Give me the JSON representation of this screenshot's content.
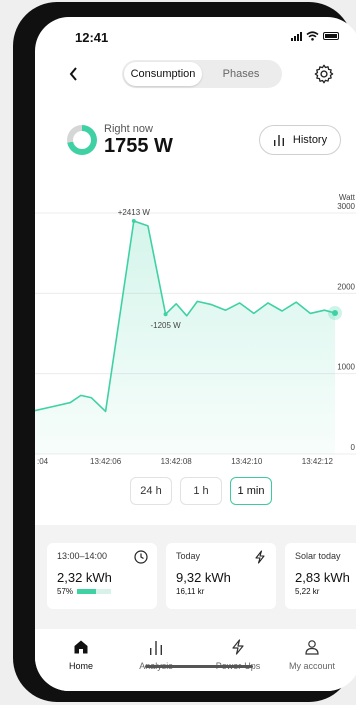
{
  "status": {
    "time": "12:41"
  },
  "tabs": [
    {
      "label": "Consumption",
      "active": true
    },
    {
      "label": "Phases",
      "active": false
    }
  ],
  "now": {
    "label": "Right now",
    "value": "1755 W",
    "fill_fraction": 0.72
  },
  "history_button": "History",
  "chart_data": {
    "type": "area",
    "unit_label": "Watt",
    "y_ticks": [
      "3000",
      "2000",
      "1000",
      "0"
    ],
    "ylim": [
      0,
      3000
    ],
    "x_tick_labels": [
      ":04",
      "13:42:06",
      "13:42:08",
      "13:42:10",
      "13:42:12"
    ],
    "x_ticks": [
      4,
      6,
      8,
      10,
      12
    ],
    "xlim": [
      4,
      12.5
    ],
    "points": [
      [
        4.0,
        540
      ],
      [
        4.5,
        590
      ],
      [
        5.0,
        640
      ],
      [
        5.3,
        730
      ],
      [
        5.6,
        700
      ],
      [
        6.0,
        530
      ],
      [
        6.8,
        2900
      ],
      [
        7.2,
        2840
      ],
      [
        7.7,
        1740
      ],
      [
        8.0,
        1870
      ],
      [
        8.3,
        1720
      ],
      [
        8.6,
        1900
      ],
      [
        9.0,
        1860
      ],
      [
        9.4,
        1790
      ],
      [
        9.8,
        1880
      ],
      [
        10.2,
        1750
      ],
      [
        10.6,
        1880
      ],
      [
        11.0,
        1780
      ],
      [
        11.4,
        1890
      ],
      [
        11.8,
        1750
      ],
      [
        12.2,
        1790
      ],
      [
        12.5,
        1755
      ]
    ],
    "annotations": [
      {
        "label": "+2413 W",
        "x": 6.8,
        "y": 2900
      },
      {
        "label": "-1205 W",
        "x": 7.7,
        "y": 1740
      }
    ],
    "color": "#3fd1a4"
  },
  "ranges": [
    {
      "label": "24 h",
      "active": false
    },
    {
      "label": "1 h",
      "active": false
    },
    {
      "label": "1 min",
      "active": true
    }
  ],
  "cards": [
    {
      "title": "13:00–14:00",
      "value": "2,32 kWh",
      "sub": "57%",
      "progress": 0.57,
      "icon": "clock-icon"
    },
    {
      "title": "Today",
      "value": "9,32 kWh",
      "sub": "16,11 kr",
      "icon": "bolt-icon"
    },
    {
      "title": "Solar today",
      "value": "2,83 kWh",
      "sub": "5,22 kr"
    }
  ],
  "nav": [
    {
      "label": "Home",
      "icon": "home-icon",
      "active": true
    },
    {
      "label": "Analysis",
      "icon": "bar-chart-icon",
      "active": false
    },
    {
      "label": "Power-Ups",
      "icon": "bolt-icon",
      "active": false
    },
    {
      "label": "My account",
      "icon": "person-icon",
      "active": false
    }
  ],
  "colors": {
    "accent": "#3fd1a4",
    "frame": "#101010"
  }
}
